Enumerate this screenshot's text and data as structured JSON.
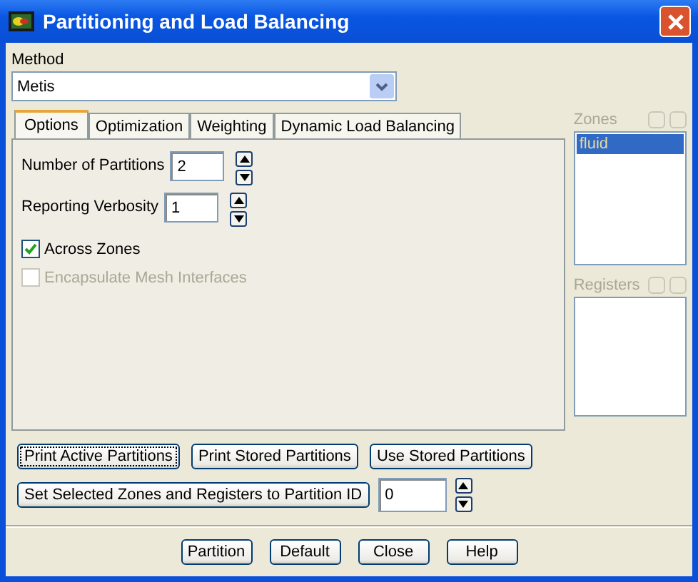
{
  "window": {
    "title": "Partitioning and Load Balancing"
  },
  "method": {
    "label": "Method",
    "value": "Metis"
  },
  "tabs": [
    {
      "label": "Options",
      "selected": true
    },
    {
      "label": "Optimization",
      "selected": false
    },
    {
      "label": "Weighting",
      "selected": false
    },
    {
      "label": "Dynamic Load Balancing",
      "selected": false
    }
  ],
  "options": {
    "fields": [
      {
        "label": "Number of Partitions",
        "value": "2"
      },
      {
        "label": "Reporting Verbosity",
        "value": "1"
      }
    ],
    "checkboxes": [
      {
        "label": "Across Zones",
        "checked": true,
        "disabled": false
      },
      {
        "label": "Encapsulate Mesh Interfaces",
        "checked": false,
        "disabled": true
      }
    ]
  },
  "zones": {
    "label": "Zones",
    "items": [
      {
        "label": "fluid",
        "selected": true
      }
    ]
  },
  "registers": {
    "label": "Registers"
  },
  "actions": [
    {
      "label": "Print Active Partitions",
      "focused": true
    },
    {
      "label": "Print Stored Partitions",
      "focused": false
    },
    {
      "label": "Use Stored Partitions",
      "focused": false
    }
  ],
  "partition_id": {
    "button": "Set Selected Zones and Registers to Partition ID",
    "value": "0"
  },
  "buttons": [
    "Partition",
    "Default",
    "Close",
    "Help"
  ]
}
